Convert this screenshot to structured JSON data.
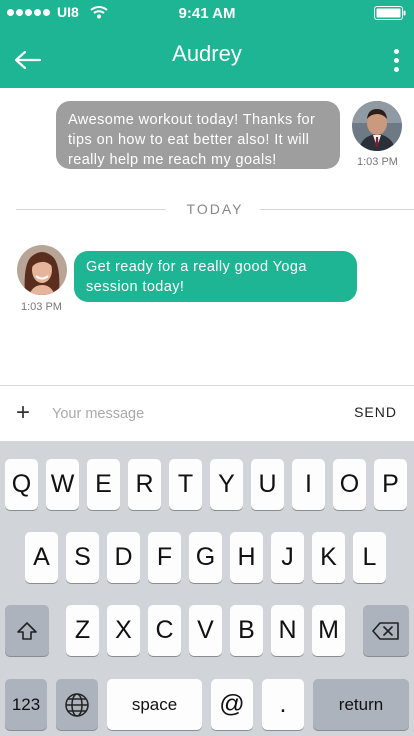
{
  "status_bar": {
    "carrier": "UI8",
    "time": "9:41 AM"
  },
  "header": {
    "title": "Audrey"
  },
  "messages": [
    {
      "text": "Awesome workout today! Thanks for tips on how to eat better also! It will really help me reach my goals!",
      "time": "1:03 PM"
    },
    {
      "text": "Get ready for a really good Yoga session today!",
      "time": "1:03 PM"
    }
  ],
  "divider": {
    "label": "TODAY"
  },
  "composer": {
    "plus": "+",
    "placeholder": "Your message",
    "send_label": "SEND"
  },
  "keyboard": {
    "row1": [
      "Q",
      "W",
      "E",
      "R",
      "T",
      "Y",
      "U",
      "I",
      "O",
      "P"
    ],
    "row2": [
      "A",
      "S",
      "D",
      "F",
      "G",
      "H",
      "J",
      "K",
      "L"
    ],
    "row3": [
      "Z",
      "X",
      "C",
      "V",
      "B",
      "N",
      "M"
    ],
    "numbers_label": "123",
    "space_label": "space",
    "at_label": "@",
    "dot_label": ".",
    "return_label": "return"
  },
  "colors": {
    "accent": "#1db593",
    "bubble_gray": "#9e9e9e",
    "keyboard_bg": "#d1d4d9"
  },
  "icons": [
    "back-arrow-icon",
    "more-vertical-icon",
    "wifi-icon",
    "battery-icon",
    "shift-icon",
    "backspace-icon",
    "globe-icon",
    "signal-dots-icon"
  ]
}
